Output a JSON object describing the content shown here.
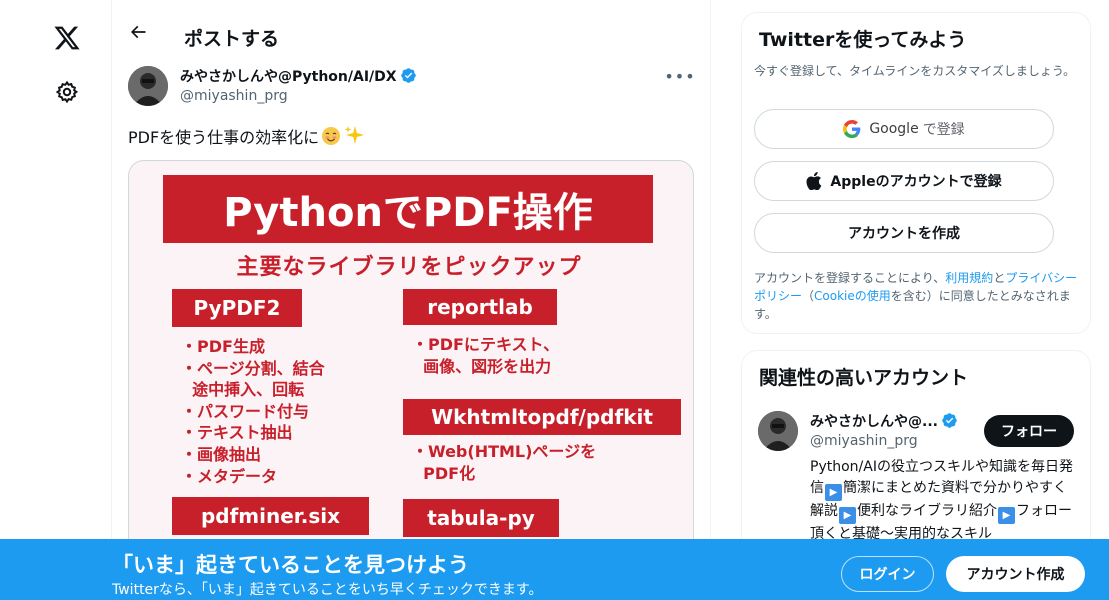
{
  "header": {
    "title": "ポストする"
  },
  "post": {
    "author_name": "みやさかしんや@Python/AI/DX",
    "author_handle": "@miyashin_prg",
    "text": "PDFを使う仕事の効率化に",
    "image": {
      "banner": "PythonでPDF操作",
      "subtitle": "主要なライブラリをピックアップ",
      "libraries": [
        {
          "name": "PyPDF2",
          "items": [
            "・PDF生成",
            "・ページ分割、結合",
            "  途中挿入、回転",
            "・パスワード付与",
            "・テキスト抽出",
            "・画像抽出",
            "・メタデータ"
          ]
        },
        {
          "name": "reportlab",
          "items": [
            "・PDFにテキスト、",
            "  画像、図形を出力"
          ]
        },
        {
          "name": "Wkhtmltopdf/pdfkit",
          "items": [
            "・Web(HTML)ページを",
            "  PDF化"
          ]
        },
        {
          "name": "pdfminer.six",
          "items": []
        },
        {
          "name": "tabula-py",
          "items": []
        }
      ]
    }
  },
  "signup_card": {
    "title": "Twitterを使ってみよう",
    "description": "今すぐ登録して、タイムラインをカスタマイズしましょう。",
    "google_label": "Google",
    "google_suffix": "で登録",
    "apple_label": "Appleのアカウントで登録",
    "create_label": "アカウントを作成",
    "terms_prefix": "アカウントを登録することにより、",
    "terms_link": "利用規約",
    "terms_and": "と",
    "privacy_link": "プライバシーポリシー",
    "terms_mid": "（",
    "cookie_link": "Cookieの使用",
    "terms_suffix": "を含む）に同意したとみなされます。"
  },
  "related": {
    "title": "関連性の高いアカウント",
    "account": {
      "name": "みやさかしんや@...",
      "handle": "@miyashin_prg",
      "follow_label": "フォロー",
      "bio_1": "Python/AIの役立つスキルや知識を毎日発信",
      "bio_2": "簡潔にまとめた資料で分かりやすく解説",
      "bio_3": "便利なライブラリ紹介",
      "bio_4": "フォロー頂くと基礎〜実用的なスキル"
    }
  },
  "bottom_bar": {
    "title": "「いま」起きていることを見つけよう",
    "subtitle": "Twitterなら、「いま」起きていることをいち早くチェックできます。",
    "login_label": "ログイン",
    "signup_label": "アカウント作成"
  },
  "colors": {
    "accent": "#1d9bf0",
    "poster_red": "#c8202a",
    "text": "#0f1419",
    "muted": "#536471"
  },
  "icons": {
    "logo": "x-logo-icon",
    "settings": "gear-icon",
    "back": "back-arrow-icon",
    "verified": "verified-badge-icon",
    "more": "more-icon",
    "google": "google-icon",
    "apple": "apple-icon"
  }
}
